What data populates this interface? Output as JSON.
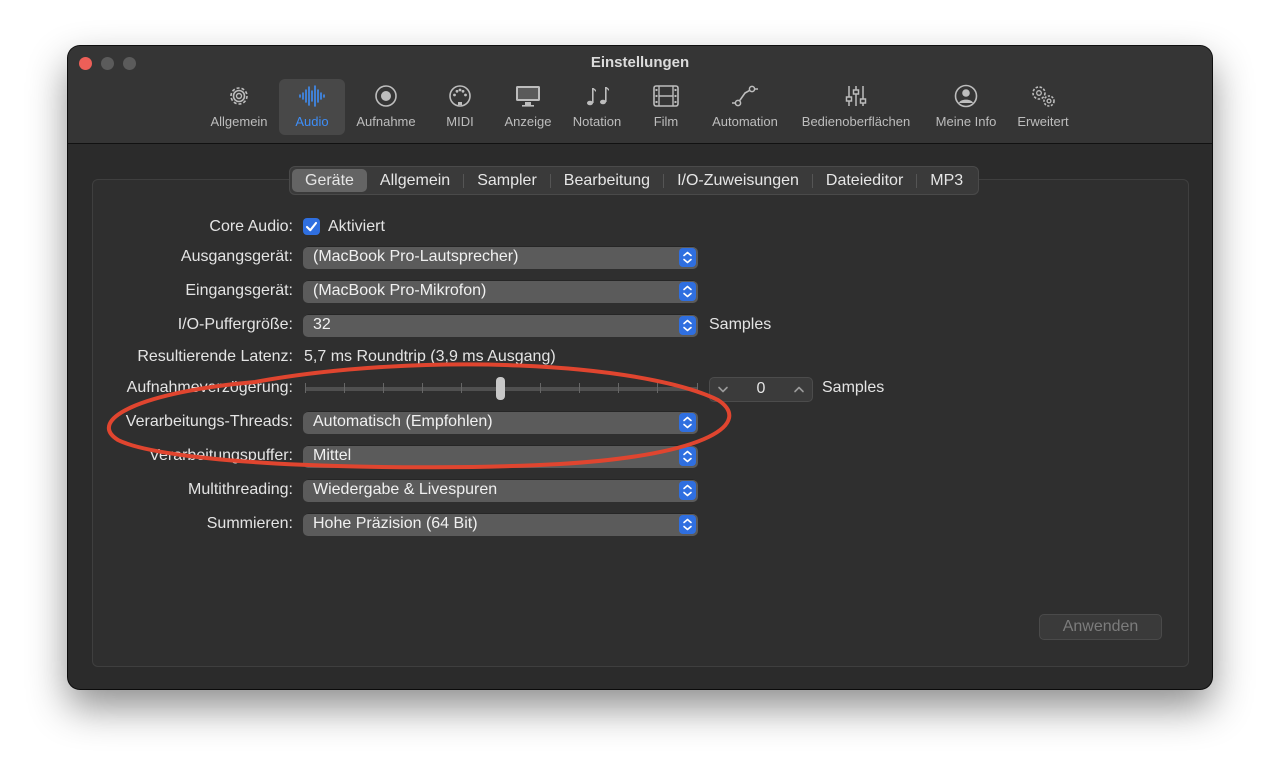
{
  "window": {
    "title": "Einstellungen"
  },
  "toolbar": {
    "items": [
      {
        "label": "Allgemein",
        "icon": "gear-icon"
      },
      {
        "label": "Audio",
        "icon": "waveform-icon",
        "active": true
      },
      {
        "label": "Aufnahme",
        "icon": "record-icon"
      },
      {
        "label": "MIDI",
        "icon": "midi-port-icon"
      },
      {
        "label": "Anzeige",
        "icon": "display-icon"
      },
      {
        "label": "Notation",
        "icon": "music-notes-icon"
      },
      {
        "label": "Film",
        "icon": "film-icon"
      },
      {
        "label": "Automation",
        "icon": "automation-curve-icon"
      },
      {
        "label": "Bedienoberflächen",
        "icon": "sliders-icon"
      },
      {
        "label": "Meine Info",
        "icon": "person-icon"
      },
      {
        "label": "Erweitert",
        "icon": "gears-icon"
      }
    ]
  },
  "tabs": [
    "Geräte",
    "Allgemein",
    "Sampler",
    "Bearbeitung",
    "I/O-Zuweisungen",
    "Dateieditor",
    "MP3"
  ],
  "active_tab": "Geräte",
  "settings": {
    "core_audio": {
      "label": "Core Audio:",
      "checkbox_label": "Aktiviert",
      "checked": true
    },
    "output_device": {
      "label": "Ausgangsgerät:",
      "value": "(MacBook Pro-Lautsprecher)"
    },
    "input_device": {
      "label": "Eingangsgerät:",
      "value": "(MacBook Pro-Mikrofon)"
    },
    "buffer_size": {
      "label": "I/O-Puffergröße:",
      "value": "32",
      "unit": "Samples"
    },
    "latency": {
      "label": "Resultierende Latenz:",
      "value": "5,7 ms Roundtrip (3,9 ms Ausgang)"
    },
    "recording_delay": {
      "label": "Aufnahmeverzögerung:",
      "value": "0",
      "unit": "Samples",
      "slider_fraction": 0.5
    },
    "processing_threads": {
      "label": "Verarbeitungs-Threads:",
      "value": "Automatisch (Empfohlen)"
    },
    "processing_buffer": {
      "label": "Verarbeitungspuffer:",
      "value": "Mittel"
    },
    "multithreading": {
      "label": "Multithreading:",
      "value": "Wiedergabe & Livespuren"
    },
    "summing": {
      "label": "Summieren:",
      "value": "Hohe Präzision (64 Bit)"
    }
  },
  "apply_button": "Anwenden",
  "colors": {
    "accent": "#3e8ef7",
    "annotation": "#e0452f",
    "close": "#ed5f58"
  }
}
